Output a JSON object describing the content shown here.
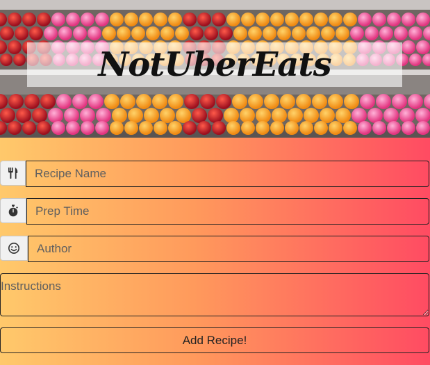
{
  "header": {
    "title": "NotUberEats"
  },
  "form": {
    "fields": [
      {
        "icon": "utensils-icon",
        "placeholder": "Recipe Name",
        "value": ""
      },
      {
        "icon": "stopwatch-icon",
        "placeholder": "Prep Time",
        "value": ""
      },
      {
        "icon": "smiley-icon",
        "placeholder": "Author",
        "value": ""
      }
    ],
    "instructions": {
      "placeholder": "Instructions",
      "value": ""
    },
    "submit_label": "Add Recipe!"
  },
  "colors": {
    "gradient_start": "#ffc96b",
    "gradient_end": "#ff4b62",
    "border": "#222222"
  }
}
